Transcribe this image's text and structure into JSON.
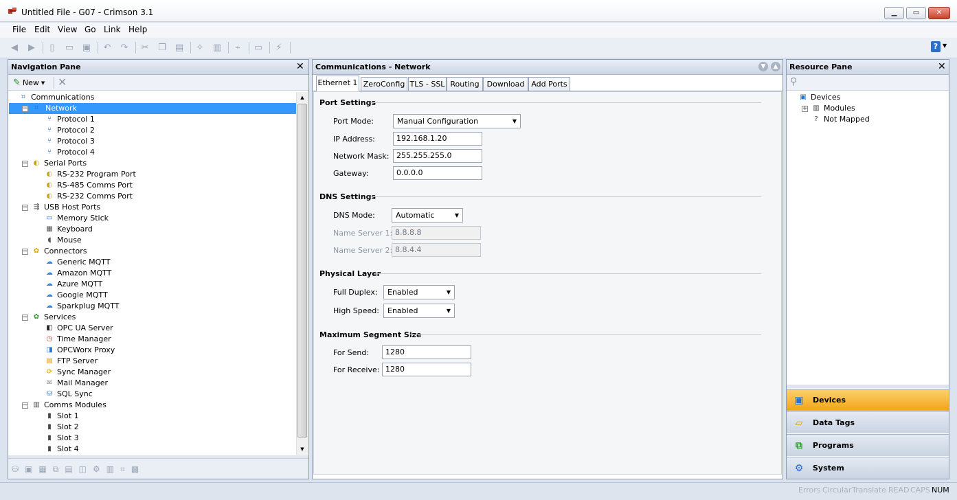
{
  "window": {
    "title": "Untitled File - G07 - Crimson 3.1"
  },
  "menu": [
    "File",
    "Edit",
    "View",
    "Go",
    "Link",
    "Help"
  ],
  "nav": {
    "title": "Navigation Pane",
    "new_label": "New",
    "tree": [
      {
        "label": "Communications",
        "level": 0,
        "icon": "network-icon",
        "toggle": ""
      },
      {
        "label": "Network",
        "level": 1,
        "icon": "network-icon",
        "toggle": "-",
        "selected": true
      },
      {
        "label": "Protocol 1",
        "level": 2,
        "icon": "protocol-icon",
        "toggle": ""
      },
      {
        "label": "Protocol 2",
        "level": 2,
        "icon": "protocol-icon",
        "toggle": ""
      },
      {
        "label": "Protocol 3",
        "level": 2,
        "icon": "protocol-icon",
        "toggle": ""
      },
      {
        "label": "Protocol 4",
        "level": 2,
        "icon": "protocol-icon",
        "toggle": ""
      },
      {
        "label": "Serial Ports",
        "level": 1,
        "icon": "serial-port-icon",
        "toggle": "-"
      },
      {
        "label": "RS-232 Program Port",
        "level": 2,
        "icon": "serial-port-icon",
        "toggle": ""
      },
      {
        "label": "RS-485 Comms Port",
        "level": 2,
        "icon": "serial-port-icon",
        "toggle": ""
      },
      {
        "label": "RS-232 Comms Port",
        "level": 2,
        "icon": "serial-port-icon",
        "toggle": ""
      },
      {
        "label": "USB Host Ports",
        "level": 1,
        "icon": "usb-icon",
        "toggle": "-"
      },
      {
        "label": "Memory Stick",
        "level": 2,
        "icon": "memory-stick-icon",
        "toggle": ""
      },
      {
        "label": "Keyboard",
        "level": 2,
        "icon": "keyboard-icon",
        "toggle": ""
      },
      {
        "label": "Mouse",
        "level": 2,
        "icon": "mouse-icon",
        "toggle": ""
      },
      {
        "label": "Connectors",
        "level": 1,
        "icon": "connectors-icon",
        "toggle": "-"
      },
      {
        "label": "Generic MQTT",
        "level": 2,
        "icon": "cloud-icon",
        "toggle": ""
      },
      {
        "label": "Amazon MQTT",
        "level": 2,
        "icon": "cloud-icon",
        "toggle": ""
      },
      {
        "label": "Azure MQTT",
        "level": 2,
        "icon": "cloud-icon",
        "toggle": ""
      },
      {
        "label": "Google MQTT",
        "level": 2,
        "icon": "cloud-icon",
        "toggle": ""
      },
      {
        "label": "Sparkplug MQTT",
        "level": 2,
        "icon": "cloud-icon",
        "toggle": ""
      },
      {
        "label": "Services",
        "level": 1,
        "icon": "services-icon",
        "toggle": "-"
      },
      {
        "label": "OPC UA Server",
        "level": 2,
        "icon": "opc-ua-icon",
        "toggle": ""
      },
      {
        "label": "Time Manager",
        "level": 2,
        "icon": "clock-icon",
        "toggle": ""
      },
      {
        "label": "OPCWorx Proxy",
        "level": 2,
        "icon": "opcworx-icon",
        "toggle": ""
      },
      {
        "label": "FTP Server",
        "level": 2,
        "icon": "ftp-icon",
        "toggle": ""
      },
      {
        "label": "Sync Manager",
        "level": 2,
        "icon": "sync-icon",
        "toggle": ""
      },
      {
        "label": "Mail Manager",
        "level": 2,
        "icon": "mail-icon",
        "toggle": ""
      },
      {
        "label": "SQL Sync",
        "level": 2,
        "icon": "sql-sync-icon",
        "toggle": ""
      },
      {
        "label": "Comms Modules",
        "level": 1,
        "icon": "rack-icon",
        "toggle": "-"
      },
      {
        "label": "Slot 1",
        "level": 2,
        "icon": "slot-icon",
        "toggle": ""
      },
      {
        "label": "Slot 2",
        "level": 2,
        "icon": "slot-icon",
        "toggle": ""
      },
      {
        "label": "Slot 3",
        "level": 2,
        "icon": "slot-icon",
        "toggle": ""
      },
      {
        "label": "Slot 4",
        "level": 2,
        "icon": "slot-icon",
        "toggle": ""
      }
    ]
  },
  "main": {
    "title": "Communications - Network",
    "tabs": [
      "Ethernet 1",
      "ZeroConfig",
      "TLS - SSL",
      "Routing",
      "Download",
      "Add Ports"
    ],
    "port_settings": {
      "heading": "Port Settings",
      "port_mode_label": "Port Mode:",
      "port_mode": "Manual Configuration",
      "ip_label": "IP Address:",
      "ip": "192.168.1.20",
      "mask_label": "Network Mask:",
      "mask": "255.255.255.0",
      "gw_label": "Gateway:",
      "gw": "0.0.0.0"
    },
    "dns": {
      "heading": "DNS Settings",
      "mode_label": "DNS Mode:",
      "mode": "Automatic",
      "ns1_label": "Name Server 1:",
      "ns1": "8.8.8.8",
      "ns2_label": "Name Server 2:",
      "ns2": "8.8.4.4"
    },
    "physical": {
      "heading": "Physical Layer",
      "duplex_label": "Full Duplex:",
      "duplex": "Enabled",
      "speed_label": "High Speed:",
      "speed": "Enabled"
    },
    "mss": {
      "heading": "Maximum Segment Size",
      "send_label": "For Send:",
      "send": "1280",
      "recv_label": "For Receive:",
      "recv": "1280"
    }
  },
  "resource": {
    "title": "Resource Pane",
    "tree": [
      {
        "label": "Devices",
        "level": 0,
        "icon": "devices-icon",
        "toggle": ""
      },
      {
        "label": "Modules",
        "level": 1,
        "icon": "rack-icon",
        "toggle": "+"
      },
      {
        "label": "Not Mapped",
        "level": 1,
        "icon": "question-icon",
        "toggle": ""
      }
    ],
    "buttons": [
      {
        "label": "Devices",
        "icon": "devices-icon",
        "active": true
      },
      {
        "label": "Data Tags",
        "icon": "data-tags-icon",
        "active": false
      },
      {
        "label": "Programs",
        "icon": "programs-icon",
        "active": false
      },
      {
        "label": "System",
        "icon": "system-icon",
        "active": false
      }
    ]
  },
  "status": {
    "errors": "Errors",
    "circular": "Circular",
    "translate": "Translate",
    "read": "READ",
    "caps": "CAPS",
    "num": "NUM"
  },
  "colors": {
    "selection": "#3399ff",
    "accent": "#f3a41a"
  }
}
